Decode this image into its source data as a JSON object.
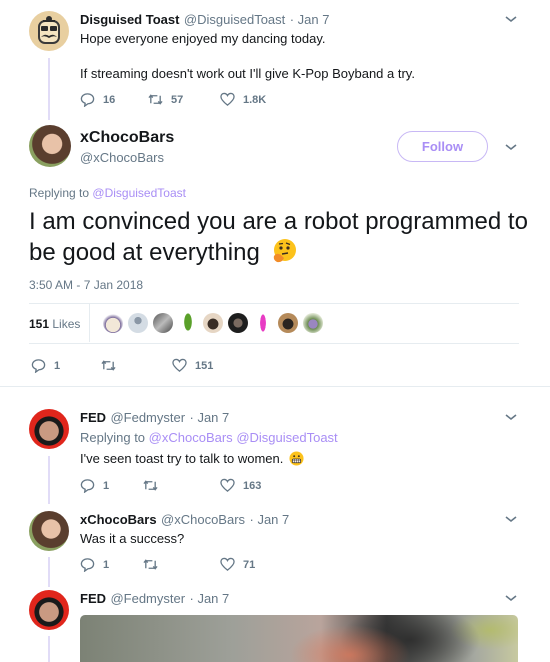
{
  "tweets": [
    {
      "name": "Disguised Toast",
      "handle": "@DisguisedToast",
      "date": "· Jan 7",
      "lines": [
        "Hope everyone enjoyed my dancing today.",
        "If streaming doesn't work out I'll give K-Pop Boyband a try."
      ],
      "replies": "16",
      "retweets": "57",
      "likes": "1.8K"
    },
    {
      "name": "xChocoBars",
      "handle": "@xChocoBars",
      "follow_label": "Follow",
      "replying_label": "Replying to",
      "replying_to": "@DisguisedToast",
      "text": "I am convinced you are a robot programmed to be good at everything",
      "emoji": "thinking-face",
      "timestamp": "3:50 AM - 7 Jan 2018",
      "likes_count": "151",
      "likes_label": "Likes",
      "likers_count": 9,
      "replies": "1",
      "retweets": "",
      "likes": "151"
    },
    {
      "name": "FED",
      "handle": "@Fedmyster",
      "date": "· Jan 7",
      "replying_label": "Replying to",
      "replying_to": [
        "@xChocoBars",
        "@DisguisedToast"
      ],
      "text": "I've seen toast try to talk to women.",
      "emoji": "grimacing-face",
      "replies": "1",
      "retweets": "",
      "likes": "163"
    },
    {
      "name": "xChocoBars",
      "handle": "@xChocoBars",
      "date": "· Jan 7",
      "text": "Was it a success?",
      "replies": "1",
      "retweets": "",
      "likes": "71"
    },
    {
      "name": "FED",
      "handle": "@Fedmyster",
      "date": "· Jan 7",
      "media": "video-thumbnail"
    }
  ],
  "colors": {
    "accent": "#a98ef5",
    "thread_line": "#e1dcf7",
    "muted": "#657786"
  }
}
